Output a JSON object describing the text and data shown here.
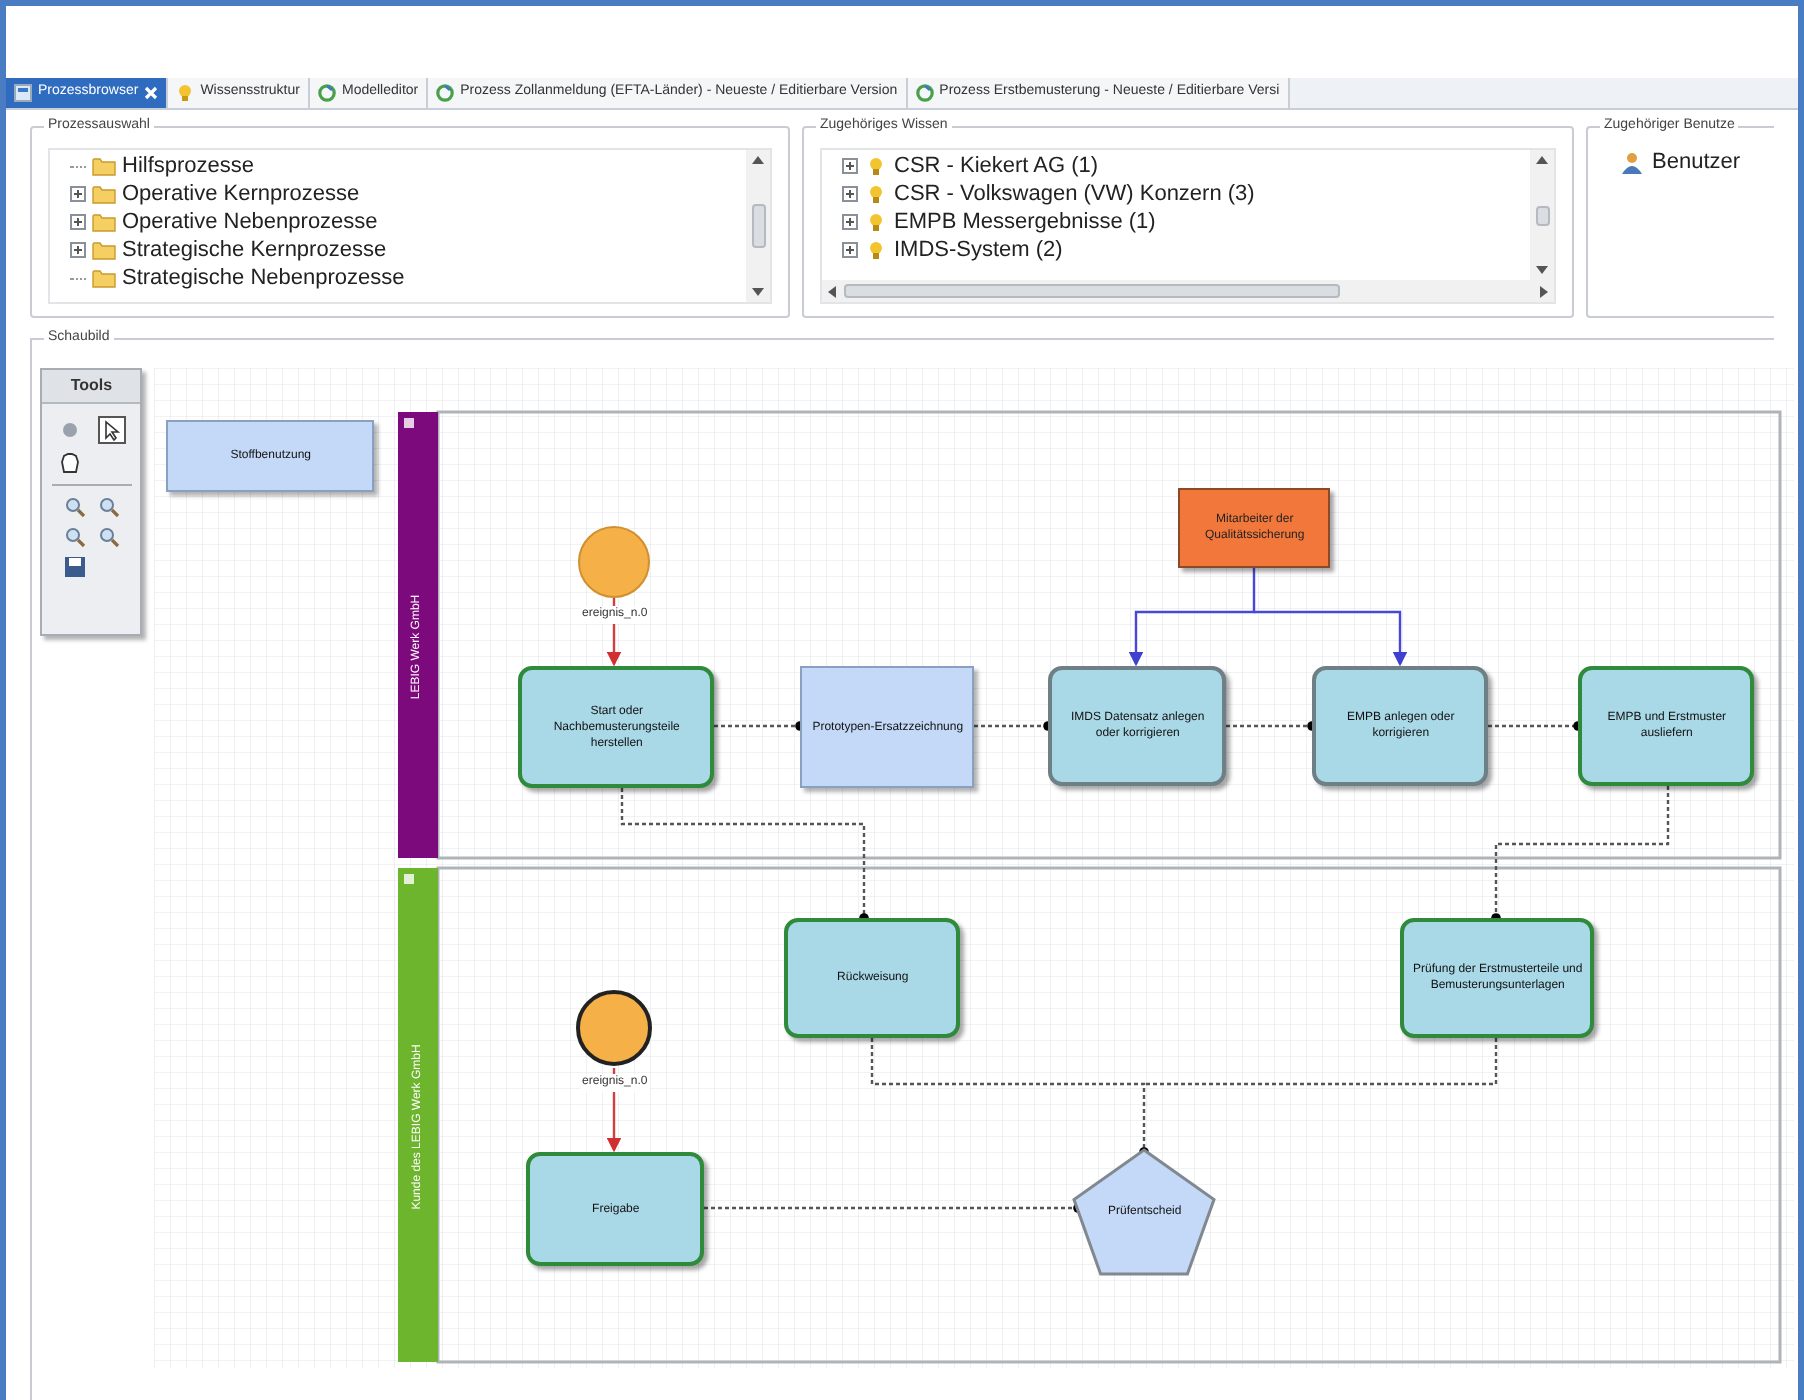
{
  "tabs": [
    {
      "label": "Prozessbrowser",
      "kind": "browser",
      "selected": true,
      "closable": true
    },
    {
      "label": "Wissensstruktur",
      "kind": "knowledge",
      "selected": false,
      "closable": false
    },
    {
      "label": "Modelleditor",
      "kind": "model",
      "selected": false,
      "closable": false
    },
    {
      "label": "Prozess Zollanmeldung (EFTA-Länder) - Neueste / Editierbare Version",
      "kind": "model",
      "selected": false,
      "closable": false
    },
    {
      "label": "Prozess Erstbemusterung - Neueste / Editierbare Versi",
      "kind": "model",
      "selected": false,
      "closable": false
    }
  ],
  "process_panel": {
    "title": "Prozessauswahl",
    "items": [
      {
        "label": "Hilfsprozesse",
        "expandable": false
      },
      {
        "label": "Operative Kernprozesse",
        "expandable": true
      },
      {
        "label": "Operative Nebenprozesse",
        "expandable": true
      },
      {
        "label": "Strategische Kernprozesse",
        "expandable": true
      },
      {
        "label": "Strategische Nebenprozesse",
        "expandable": false
      }
    ]
  },
  "knowledge_panel": {
    "title": "Zugehöriges Wissen",
    "items": [
      {
        "label": "CSR - Kiekert AG (1)"
      },
      {
        "label": "CSR - Volkswagen (VW) Konzern (3)"
      },
      {
        "label": "EMPB Messergebnisse (1)"
      },
      {
        "label": "IMDS-System (2)"
      }
    ]
  },
  "user_panel": {
    "title": "Zugehöriger Benutze",
    "items": [
      {
        "label": "Benutzer"
      }
    ]
  },
  "diagram": {
    "title": "Schaubild",
    "tools_title": "Tools",
    "lanes": [
      {
        "label": "LEBIG Werk GmbH",
        "color": "#7d0a7d"
      },
      {
        "label": "Kunde des LEBIG Werk GmbH",
        "color": "#6cb52d"
      }
    ],
    "nodes": [
      {
        "kind": "document",
        "text": "Stoffbenutzung"
      },
      {
        "kind": "start",
        "text": "ereignis_n.0"
      },
      {
        "kind": "task",
        "text": "Start oder Nachbemusterungsteile herstellen",
        "color": "#2f8a3c"
      },
      {
        "kind": "document",
        "text": "Prototypen-Ersatzzeichnung"
      },
      {
        "kind": "task",
        "text": "IMDS Datensatz anlegen oder korrigieren",
        "color": "#6f7f86"
      },
      {
        "kind": "task",
        "text": "EMPB anlegen oder korrigieren",
        "color": "#6f7f86"
      },
      {
        "kind": "task",
        "text": "EMPB und Erstmuster ausliefern",
        "color": "#2f8a3c"
      },
      {
        "kind": "role",
        "text": "Mitarbeiter der Qualitätssicherung"
      },
      {
        "kind": "task",
        "text": "Rückweisung",
        "color": "#2f8a3c"
      },
      {
        "kind": "task",
        "text": "Prüfung der Erstmusterteile und Bemusterungsunterlagen",
        "color": "#2f8a3c"
      },
      {
        "kind": "start",
        "text": "ereignis_n.0"
      },
      {
        "kind": "task",
        "text": "Freigabe",
        "color": "#2f8a3c"
      },
      {
        "kind": "gateway",
        "text": "Prüfentscheid"
      }
    ]
  }
}
